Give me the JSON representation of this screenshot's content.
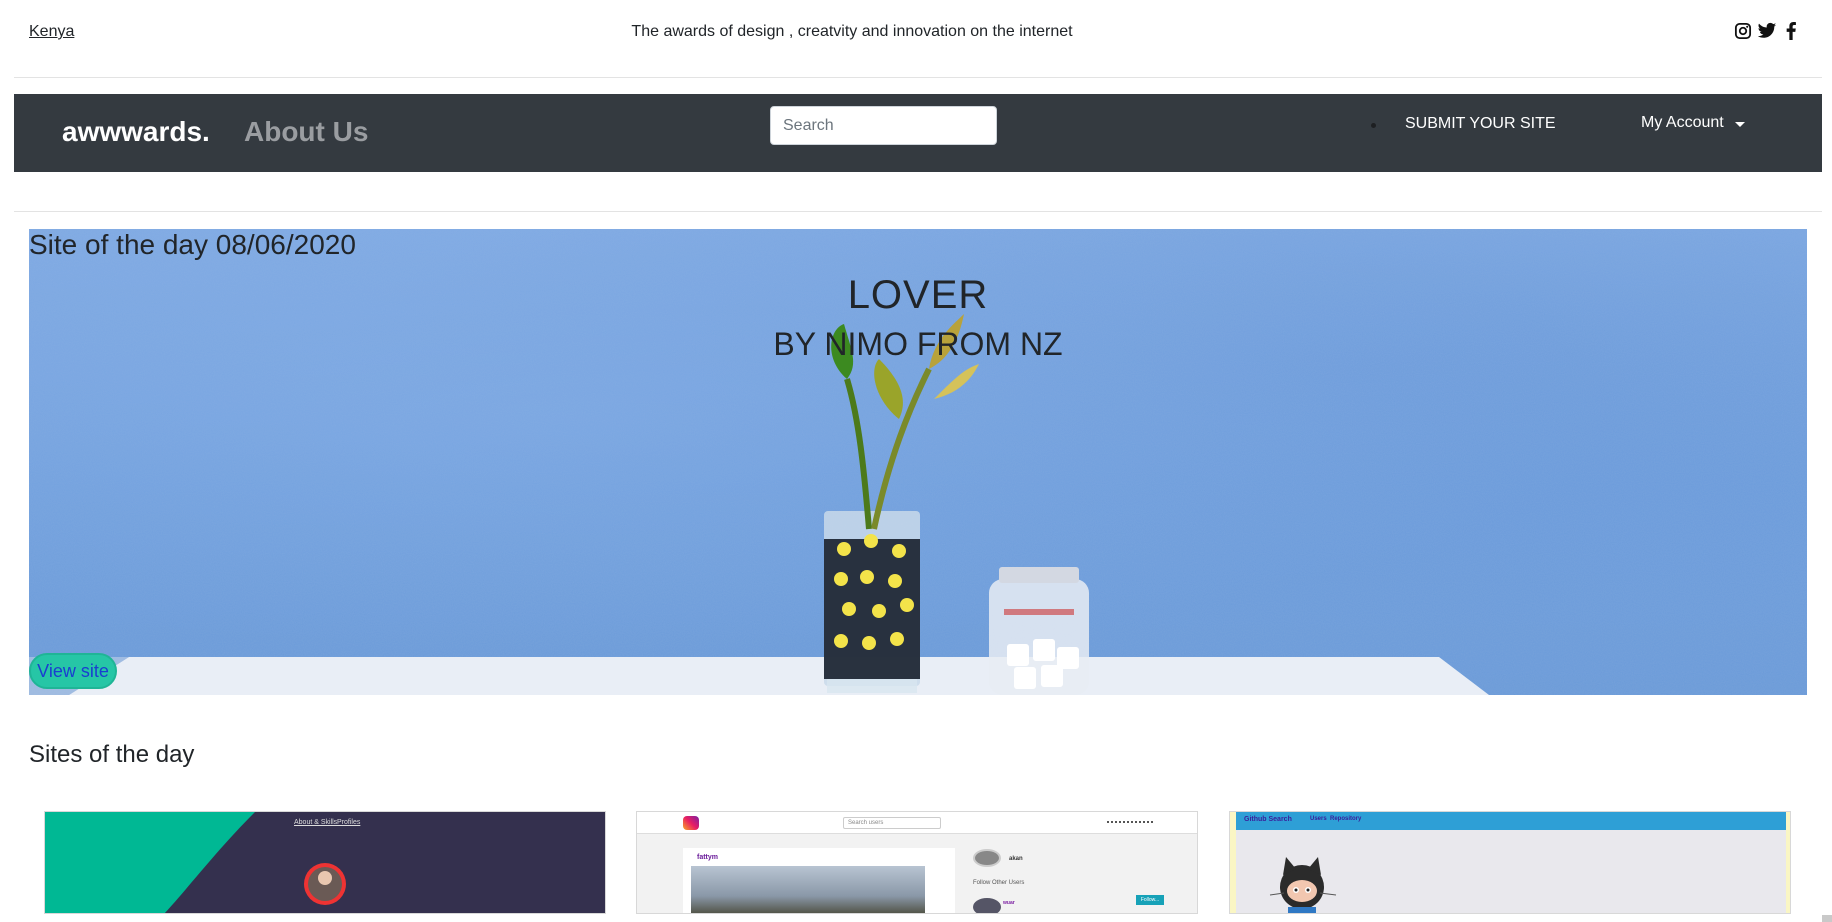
{
  "topbar": {
    "location": "Kenya",
    "tagline": "The awards of design , creatvity and innovation on the internet",
    "social_icons": [
      "instagram-icon",
      "twitter-icon",
      "facebook-icon"
    ]
  },
  "navbar": {
    "brand": "awwwards.",
    "about": "About Us",
    "search_placeholder": "Search",
    "submit": "SUBMIT YOUR SITE",
    "account_icon_glyph": "",
    "account": "My Account"
  },
  "hero": {
    "label": "Site of the day 08/06/2020",
    "title": "LOVER",
    "byline": "BY NIMO FROM NZ",
    "view_button": "View site"
  },
  "sites": {
    "heading": "Sites of the day",
    "cards": [
      {
        "nav_a": "About & Skills",
        "nav_b": "Profiles"
      },
      {
        "search": "Search users",
        "user": "fattym",
        "other_user": "akan",
        "follow_heading": "Follow Other Users",
        "follow_btn": "Follow...",
        "small_user": "wuar"
      },
      {
        "title": "Github Search",
        "nav_a": "Users",
        "nav_b": "Repository"
      }
    ]
  },
  "colors": {
    "navbar": "#343a40",
    "hero_wall": "#6e9edd",
    "view_button": "#26c6a6",
    "card1_accent": "#00b894",
    "card3_header": "#2e9fd6"
  }
}
